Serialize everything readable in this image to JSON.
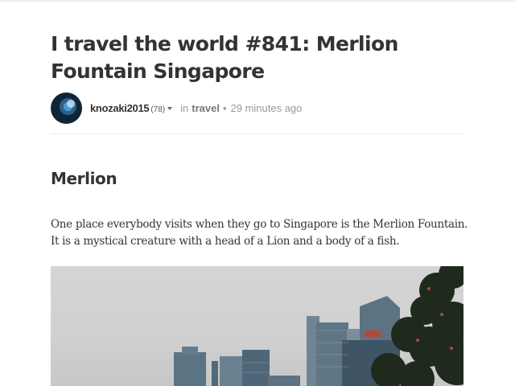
{
  "post": {
    "title": "I travel the world #841: Merlion Fountain Singapore",
    "author": "knozaki2015",
    "reputation": "(78)",
    "in_label": "in",
    "category": "travel",
    "separator": "•",
    "time": "29 minutes ago"
  },
  "content": {
    "heading": "Merlion",
    "paragraph": "One place everybody visits when they go to Singapore is the Merlion Fountain. It is a mystical creature with a head of a Lion and a body of a fish.",
    "image_subject": "Singapore skyline"
  },
  "colors": {
    "text": "#333333",
    "muted": "#999999",
    "divider": "#eeeeee",
    "sky": "#d4d5d4",
    "buildings": "#4d6470"
  }
}
